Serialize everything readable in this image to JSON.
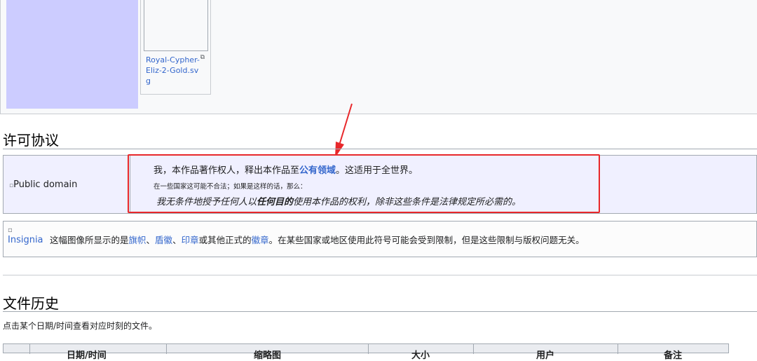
{
  "gallery": {
    "thumb_caption": "Royal-Cypher-Eliz-2-Gold.svg"
  },
  "license": {
    "heading": "许可协议",
    "image_alt": "Public domain",
    "line1_prefix": "我，本作品著作权人，释出本作品至",
    "line1_link": "公有领域",
    "line1_suffix": "。这适用于全世界。",
    "line2": "在一些国家这可能不合法；如果是这样的话，那么：",
    "line3_prefix": "我无条件地授予任何人以",
    "line3_bold": "任何目的",
    "line3_suffix": "使用本作品的权利，除非这些条件是法律规定所必需的。"
  },
  "insignia": {
    "image_alt": "Insignia",
    "text_prefix": "这幅图像所显示的是",
    "link_flag": "旗帜",
    "sep1": "、",
    "link_shield": "盾徽",
    "sep2": "、",
    "link_seal": "印章",
    "text_mid": "或其他正式的",
    "link_emblem": "徽章",
    "text_suffix": "。在某些国家或地区使用此符号可能会受到限制，但是这些限制与版权问题无关。"
  },
  "history": {
    "heading": "文件历史",
    "hint": "点击某个日期/时间查看对应时刻的文件。",
    "columns": [
      "日期/时间",
      "缩略图",
      "大小",
      "用户",
      "备注"
    ]
  },
  "colors": {
    "link": "#3366cc",
    "highlight_frame": "#e8282b",
    "license_bg": "#f0f0ff",
    "lavender_block": "#ccccff"
  }
}
